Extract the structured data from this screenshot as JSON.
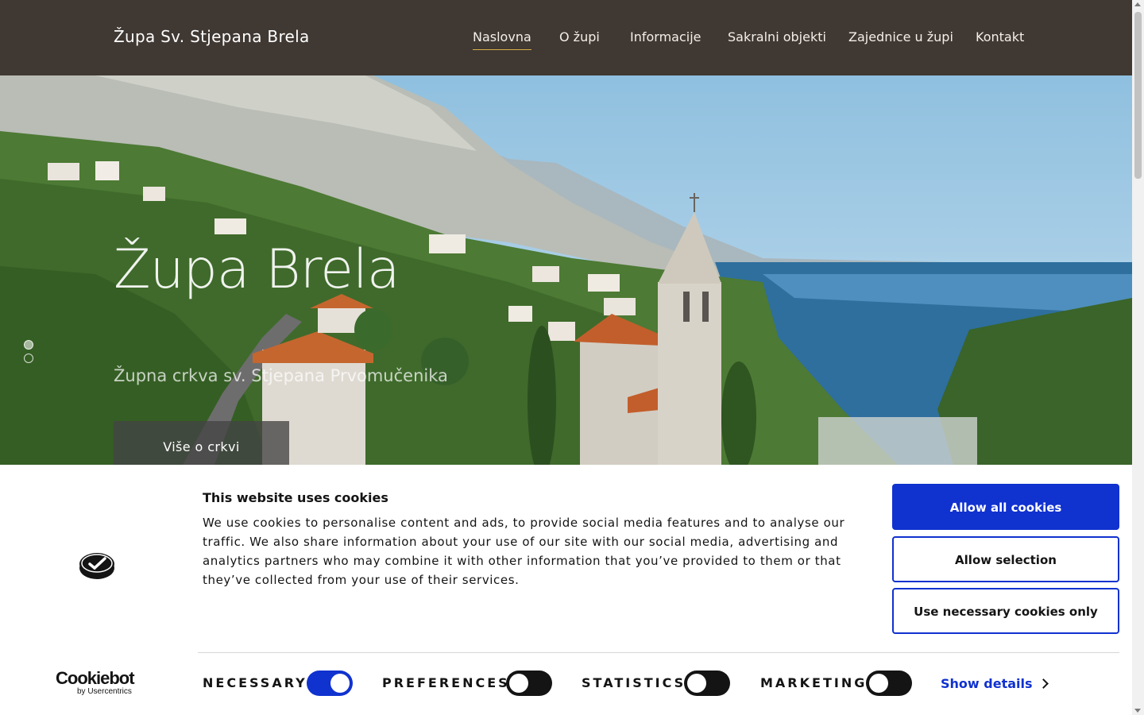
{
  "header": {
    "brand": "Župa Sv. Stjepana Brela",
    "nav": [
      {
        "label": "Naslovna",
        "active": true
      },
      {
        "label": "O župi",
        "active": false
      },
      {
        "label": "Informacije",
        "active": false
      },
      {
        "label": "Sakralni objekti",
        "active": false
      },
      {
        "label": "Zajednice u župi",
        "active": false
      },
      {
        "label": "Kontakt",
        "active": false
      }
    ]
  },
  "hero": {
    "title": "Župa Brela",
    "subtitle": "Župna crkva sv. Stjepana Prvomučenika",
    "button_label": "Više o crkvi",
    "slides_total": 2,
    "active_slide": 1
  },
  "cookie_banner": {
    "title": "This website uses cookies",
    "body": "We use cookies to personalise content and ads, to provide social media features and to analyse our traffic. We also share information about your use of our site with our social media, advertising and analytics partners who may combine it with other information that you’ve provided to them or that they’ve collected from your use of their services.",
    "buttons": {
      "allow_all": "Allow all cookies",
      "allow_selection": "Allow selection",
      "necessary_only": "Use necessary cookies only"
    },
    "toggles": [
      {
        "label": "NECESSARY",
        "on": true
      },
      {
        "label": "PREFERENCES",
        "on": false
      },
      {
        "label": "STATISTICS",
        "on": false
      },
      {
        "label": "MARKETING",
        "on": false
      }
    ],
    "show_details": "Show details",
    "brand_name": "Cookiebot",
    "brand_sub": "by Usercentrics"
  },
  "colors": {
    "header_bg": "#403832",
    "nav_active_underline": "#d6b04a",
    "cookie_accent": "#1032cf"
  }
}
